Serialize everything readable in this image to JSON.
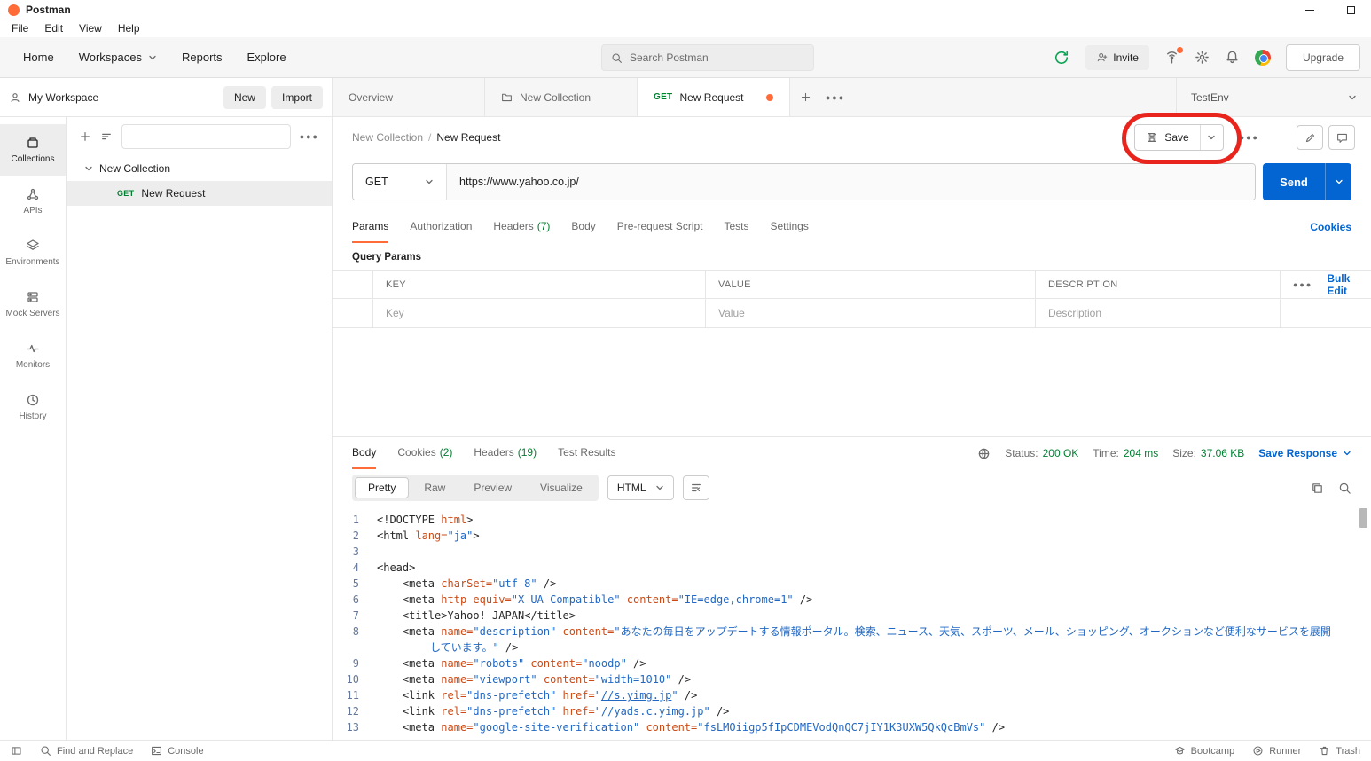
{
  "titlebar": {
    "app_name": "Postman",
    "menu": [
      "File",
      "Edit",
      "View",
      "Help"
    ]
  },
  "topnav": {
    "home": "Home",
    "workspaces": "Workspaces",
    "reports": "Reports",
    "explore": "Explore",
    "search_placeholder": "Search Postman",
    "invite": "Invite",
    "upgrade": "Upgrade"
  },
  "sidebar": {
    "workspace": "My Workspace",
    "new_button": "New",
    "import_button": "Import",
    "rail": [
      {
        "label": "Collections"
      },
      {
        "label": "APIs"
      },
      {
        "label": "Environments"
      },
      {
        "label": "Mock Servers"
      },
      {
        "label": "Monitors"
      },
      {
        "label": "History"
      }
    ],
    "collection_name": "New Collection",
    "request_method": "GET",
    "request_name": "New Request"
  },
  "tabbar": {
    "overview": "Overview",
    "collection": "New Collection",
    "request_method": "GET",
    "request_name": "New Request",
    "environment": "TestEnv"
  },
  "requestpane": {
    "breadcrumb_collection": "New Collection",
    "breadcrumb_separator": "/",
    "breadcrumb_request": "New Request",
    "save_label": "Save",
    "method": "GET",
    "url": "https://www.yahoo.co.jp/",
    "send_label": "Send",
    "tabs": [
      {
        "label": "Params"
      },
      {
        "label": "Authorization"
      },
      {
        "label": "Headers",
        "count": "(7)"
      },
      {
        "label": "Body"
      },
      {
        "label": "Pre-request Script"
      },
      {
        "label": "Tests"
      },
      {
        "label": "Settings"
      }
    ],
    "cookies_link": "Cookies",
    "query_params_title": "Query Params",
    "table": {
      "key_header": "KEY",
      "value_header": "VALUE",
      "description_header": "DESCRIPTION",
      "bulk_edit": "Bulk Edit",
      "key_placeholder": "Key",
      "value_placeholder": "Value",
      "description_placeholder": "Description"
    }
  },
  "responsepane": {
    "tabs": [
      {
        "label": "Body"
      },
      {
        "label": "Cookies",
        "count": "(2)"
      },
      {
        "label": "Headers",
        "count": "(19)"
      },
      {
        "label": "Test Results"
      }
    ],
    "status_label": "Status:",
    "status_value": "200 OK",
    "time_label": "Time:",
    "time_value": "204 ms",
    "size_label": "Size:",
    "size_value": "37.06 KB",
    "save_response": "Save Response",
    "view_tabs": [
      "Pretty",
      "Raw",
      "Preview",
      "Visualize"
    ],
    "language": "HTML",
    "code_lines": [
      {
        "num": "1",
        "segs": [
          [
            "t",
            "<!DOCTYPE "
          ],
          [
            "a",
            "html"
          ],
          [
            "t",
            ">"
          ]
        ]
      },
      {
        "num": "2",
        "segs": [
          [
            "t",
            "<html "
          ],
          [
            "a",
            "lang="
          ],
          [
            "s",
            "\"ja\""
          ],
          [
            "t",
            ">"
          ]
        ]
      },
      {
        "num": "3",
        "segs": []
      },
      {
        "num": "4",
        "segs": [
          [
            "t",
            "<head>"
          ]
        ]
      },
      {
        "num": "5",
        "segs": [
          [
            "p",
            "    "
          ],
          [
            "t",
            "<meta "
          ],
          [
            "a",
            "charSet="
          ],
          [
            "s",
            "\"utf-8\""
          ],
          [
            "t",
            " />"
          ]
        ]
      },
      {
        "num": "6",
        "segs": [
          [
            "p",
            "    "
          ],
          [
            "t",
            "<meta "
          ],
          [
            "a",
            "http-equiv="
          ],
          [
            "s",
            "\"X-UA-Compatible\""
          ],
          [
            "a",
            " content="
          ],
          [
            "s",
            "\"IE=edge,chrome=1\""
          ],
          [
            "t",
            " />"
          ]
        ]
      },
      {
        "num": "7",
        "segs": [
          [
            "p",
            "    "
          ],
          [
            "t",
            "<title>"
          ],
          [
            "p",
            "Yahoo! JAPAN"
          ],
          [
            "t",
            "</title>"
          ]
        ]
      },
      {
        "num": "8",
        "segs": [
          [
            "p",
            "    "
          ],
          [
            "t",
            "<meta "
          ],
          [
            "a",
            "name="
          ],
          [
            "s",
            "\"description\""
          ],
          [
            "a",
            " content="
          ],
          [
            "s",
            "\"あなたの毎日をアップデートする情報ポータル。検索、ニュース、天気、スポーツ、メール、ショッピング、オークションなど便利なサービスを展開しています。\""
          ],
          [
            "t",
            " />"
          ]
        ]
      },
      {
        "num": "9",
        "segs": [
          [
            "p",
            "    "
          ],
          [
            "t",
            "<meta "
          ],
          [
            "a",
            "name="
          ],
          [
            "s",
            "\"robots\""
          ],
          [
            "a",
            " content="
          ],
          [
            "s",
            "\"noodp\""
          ],
          [
            "t",
            " />"
          ]
        ]
      },
      {
        "num": "10",
        "segs": [
          [
            "p",
            "    "
          ],
          [
            "t",
            "<meta "
          ],
          [
            "a",
            "name="
          ],
          [
            "s",
            "\"viewport\""
          ],
          [
            "a",
            " content="
          ],
          [
            "s",
            "\"width=1010\""
          ],
          [
            "t",
            " />"
          ]
        ]
      },
      {
        "num": "11",
        "segs": [
          [
            "p",
            "    "
          ],
          [
            "t",
            "<link "
          ],
          [
            "a",
            "rel="
          ],
          [
            "s",
            "\"dns-prefetch\""
          ],
          [
            "a",
            " href="
          ],
          [
            "s",
            "\""
          ],
          [
            "l",
            "//s.yimg.jp"
          ],
          [
            "s",
            "\""
          ],
          [
            "t",
            " />"
          ]
        ]
      },
      {
        "num": "12",
        "segs": [
          [
            "p",
            "    "
          ],
          [
            "t",
            "<link "
          ],
          [
            "a",
            "rel="
          ],
          [
            "s",
            "\"dns-prefetch\""
          ],
          [
            "a",
            " href="
          ],
          [
            "s",
            "\"//yads.c.yimg.jp\""
          ],
          [
            "t",
            " />"
          ]
        ]
      },
      {
        "num": "13",
        "segs": [
          [
            "p",
            "    "
          ],
          [
            "t",
            "<meta "
          ],
          [
            "a",
            "name="
          ],
          [
            "s",
            "\"google-site-verification\""
          ],
          [
            "a",
            " content="
          ],
          [
            "s",
            "\"fsLMOiigp5fIpCDMEVodQnQC7jIY1K3UXW5QkQcBmVs\""
          ],
          [
            "t",
            " />"
          ]
        ]
      }
    ]
  },
  "statusbar": {
    "find_replace": "Find and Replace",
    "console": "Console",
    "bootcamp": "Bootcamp",
    "runner": "Runner",
    "trash": "Trash"
  }
}
